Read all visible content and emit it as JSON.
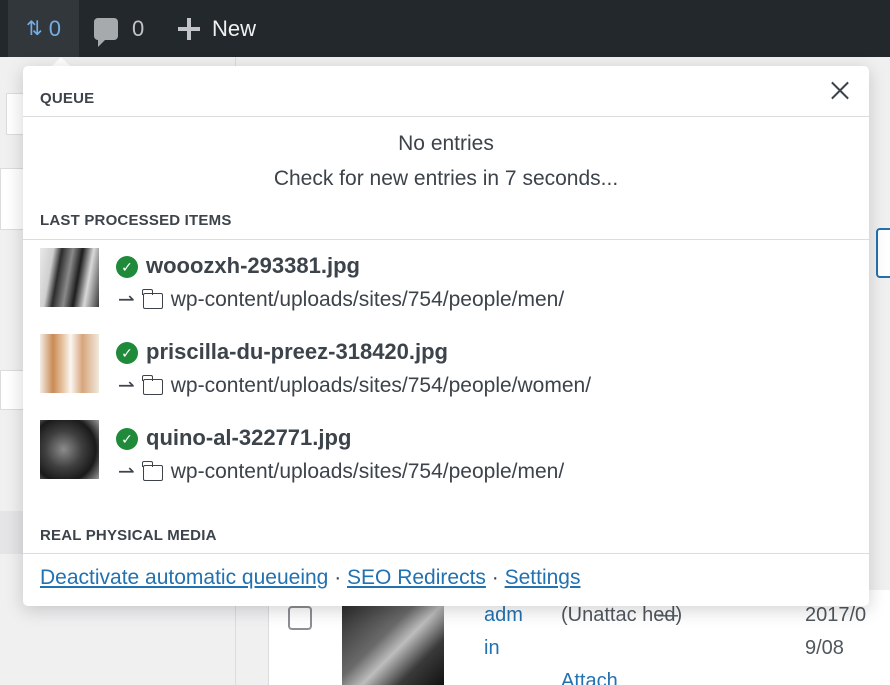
{
  "adminbar": {
    "queue_count": "0",
    "comments_count": "0",
    "new_label": "New"
  },
  "popup": {
    "queue_heading": "QUEUE",
    "no_entries": "No entries",
    "check_message": "Check for new entries in 7 seconds...",
    "last_processed_heading": "LAST PROCESSED ITEMS",
    "items": [
      {
        "filename": "wooozxh-293381.jpg",
        "path": "wp-content/uploads/sites/754/people/men/"
      },
      {
        "filename": "priscilla-du-preez-318420.jpg",
        "path": "wp-content/uploads/sites/754/people/women/"
      },
      {
        "filename": "quino-al-322771.jpg",
        "path": "wp-content/uploads/sites/754/people/men/"
      }
    ],
    "rpm_heading": "REAL PHYSICAL MEDIA",
    "links": {
      "deactivate": "Deactivate automatic queueing",
      "seo": "SEO Redirects",
      "settings": "Settings",
      "separator": " · "
    },
    "arrow_glyph": "⇀",
    "check_glyph": "✓",
    "close_icon": "close-icon"
  },
  "background": {
    "author": "adm in",
    "attached": "(Unattac hed)",
    "dash": "—",
    "attach_link": "Attach",
    "date": "2017/0 9/08"
  }
}
